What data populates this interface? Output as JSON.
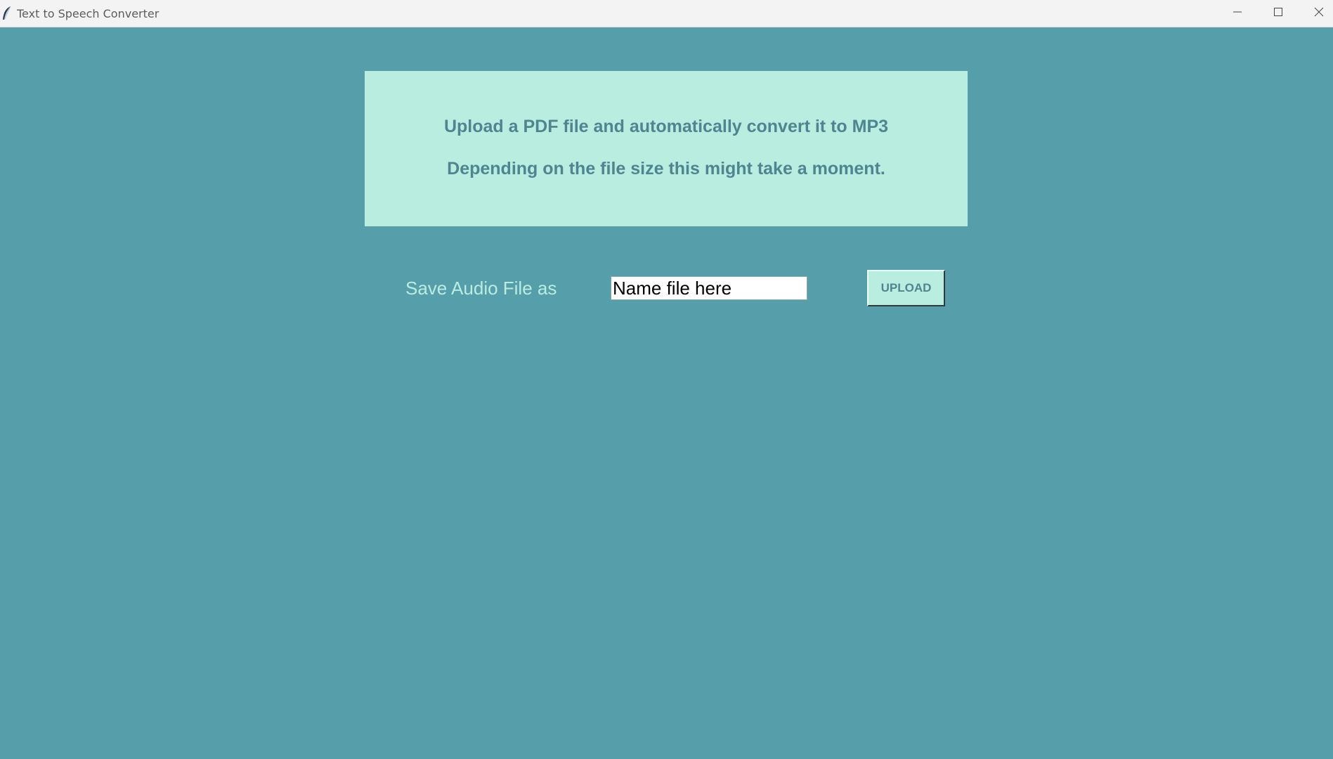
{
  "window": {
    "title": "Text to Speech Converter",
    "icons": {
      "app": "feather-icon",
      "minimize": "minimize-icon",
      "maximize": "maximize-icon",
      "close": "close-icon"
    }
  },
  "info": {
    "line1": "Upload a PDF file and automatically convert it to MP3",
    "line2": "Depending on the file size this might take a moment."
  },
  "form": {
    "save_label": "Save Audio File as",
    "filename_value": "Name file here",
    "upload_label": "UPLOAD"
  },
  "colors": {
    "background": "#559eaa",
    "panel": "#b9ede0",
    "panel_text": "#4f8590"
  }
}
